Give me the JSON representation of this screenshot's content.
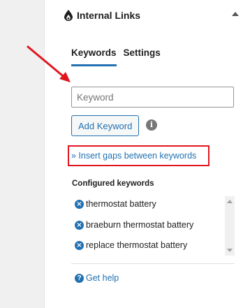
{
  "panel": {
    "title": "Internal Links",
    "plugin_icon": "drop-flame-icon",
    "collapse_icon": "chevron-up-icon"
  },
  "tabs": [
    {
      "label": "Keywords",
      "active": true
    },
    {
      "label": "Settings",
      "active": false
    }
  ],
  "keyword_input": {
    "value": "",
    "placeholder": "Keyword"
  },
  "add_keyword_button": {
    "label": "Add Keyword"
  },
  "info_icon": {
    "glyph": "i"
  },
  "gaps_link": {
    "label": "» Insert gaps between keywords"
  },
  "configured": {
    "heading": "Configured keywords",
    "keywords": [
      "thermostat battery",
      "braeburn thermostat battery",
      "replace thermostat battery"
    ]
  },
  "help": {
    "label": "Get help",
    "glyph": "?"
  },
  "colors": {
    "accent": "#2271b1",
    "annotation": "#e0161f",
    "gutter": "#f0f0f1"
  }
}
